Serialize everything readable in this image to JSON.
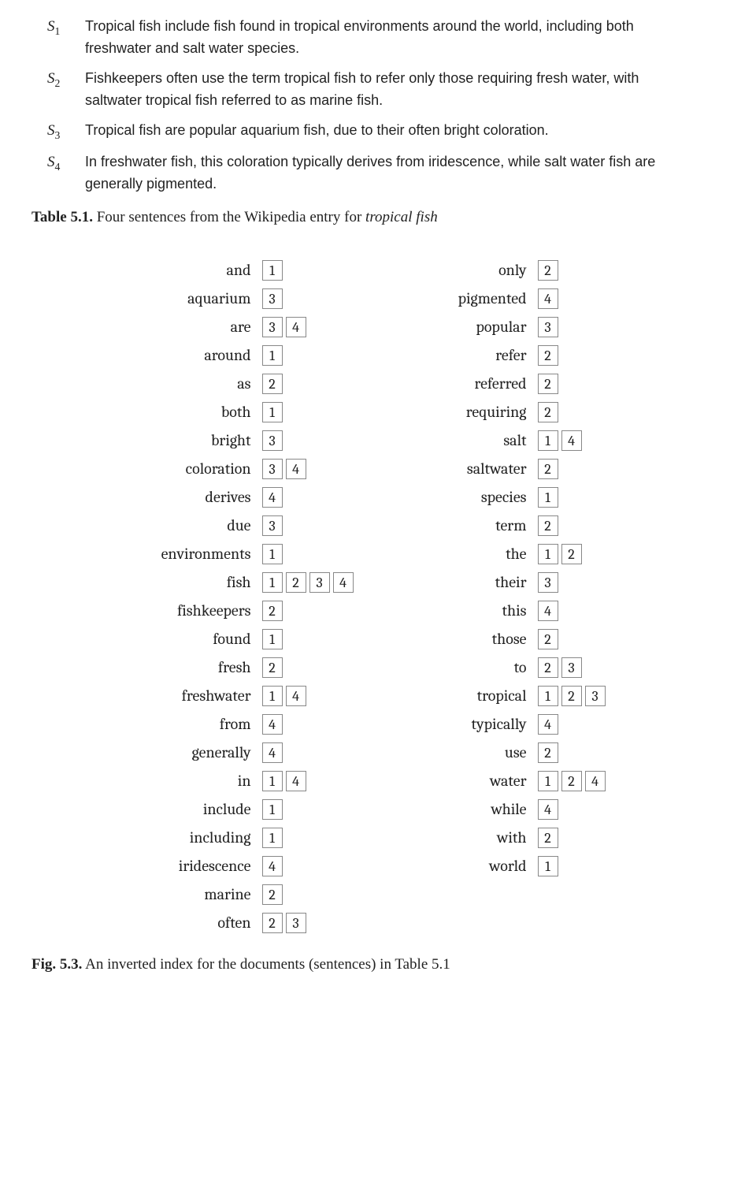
{
  "sentences": [
    {
      "label_base": "S",
      "label_sub": "1",
      "text": "Tropical fish include fish found in tropical environments around the world, including both freshwater and salt water species."
    },
    {
      "label_base": "S",
      "label_sub": "2",
      "text": "Fishkeepers often use the term tropical fish to refer only those requiring fresh water, with saltwater tropical fish referred to as marine fish."
    },
    {
      "label_base": "S",
      "label_sub": "3",
      "text": "Tropical fish are popular aquarium fish, due to their often bright coloration."
    },
    {
      "label_base": "S",
      "label_sub": "4",
      "text": "In freshwater fish, this coloration typically derives from iridescence, while salt water fish are generally pigmented."
    }
  ],
  "table_caption": {
    "label": "Table 5.1.",
    "pre": " Four sentences from the Wikipedia entry for ",
    "italic": "tropical fish"
  },
  "fig_caption": {
    "label": "Fig. 5.3.",
    "text": " An inverted index for the documents (sentences) in Table 5.1"
  },
  "index_columns": [
    [
      {
        "term": "and",
        "postings": [
          1
        ]
      },
      {
        "term": "aquarium",
        "postings": [
          3
        ]
      },
      {
        "term": "are",
        "postings": [
          3,
          4
        ]
      },
      {
        "term": "around",
        "postings": [
          1
        ]
      },
      {
        "term": "as",
        "postings": [
          2
        ]
      },
      {
        "term": "both",
        "postings": [
          1
        ]
      },
      {
        "term": "bright",
        "postings": [
          3
        ]
      },
      {
        "term": "coloration",
        "postings": [
          3,
          4
        ]
      },
      {
        "term": "derives",
        "postings": [
          4
        ]
      },
      {
        "term": "due",
        "postings": [
          3
        ]
      },
      {
        "term": "environments",
        "postings": [
          1
        ]
      },
      {
        "term": "fish",
        "postings": [
          1,
          2,
          3,
          4
        ]
      },
      {
        "term": "fishkeepers",
        "postings": [
          2
        ]
      },
      {
        "term": "found",
        "postings": [
          1
        ]
      },
      {
        "term": "fresh",
        "postings": [
          2
        ]
      },
      {
        "term": "freshwater",
        "postings": [
          1,
          4
        ]
      },
      {
        "term": "from",
        "postings": [
          4
        ]
      },
      {
        "term": "generally",
        "postings": [
          4
        ]
      },
      {
        "term": "in",
        "postings": [
          1,
          4
        ]
      },
      {
        "term": "include",
        "postings": [
          1
        ]
      },
      {
        "term": "including",
        "postings": [
          1
        ]
      },
      {
        "term": "iridescence",
        "postings": [
          4
        ]
      },
      {
        "term": "marine",
        "postings": [
          2
        ]
      },
      {
        "term": "often",
        "postings": [
          2,
          3
        ]
      }
    ],
    [
      {
        "term": "only",
        "postings": [
          2
        ]
      },
      {
        "term": "pigmented",
        "postings": [
          4
        ]
      },
      {
        "term": "popular",
        "postings": [
          3
        ]
      },
      {
        "term": "refer",
        "postings": [
          2
        ]
      },
      {
        "term": "referred",
        "postings": [
          2
        ]
      },
      {
        "term": "requiring",
        "postings": [
          2
        ]
      },
      {
        "term": "salt",
        "postings": [
          1,
          4
        ]
      },
      {
        "term": "saltwater",
        "postings": [
          2
        ]
      },
      {
        "term": "species",
        "postings": [
          1
        ]
      },
      {
        "term": "term",
        "postings": [
          2
        ]
      },
      {
        "term": "the",
        "postings": [
          1,
          2
        ]
      },
      {
        "term": "their",
        "postings": [
          3
        ]
      },
      {
        "term": "this",
        "postings": [
          4
        ]
      },
      {
        "term": "those",
        "postings": [
          2
        ]
      },
      {
        "term": "to",
        "postings": [
          2,
          3
        ]
      },
      {
        "term": "tropical",
        "postings": [
          1,
          2,
          3
        ]
      },
      {
        "term": "typically",
        "postings": [
          4
        ]
      },
      {
        "term": "use",
        "postings": [
          2
        ]
      },
      {
        "term": "water",
        "postings": [
          1,
          2,
          4
        ]
      },
      {
        "term": "while",
        "postings": [
          4
        ]
      },
      {
        "term": "with",
        "postings": [
          2
        ]
      },
      {
        "term": "world",
        "postings": [
          1
        ]
      }
    ]
  ]
}
